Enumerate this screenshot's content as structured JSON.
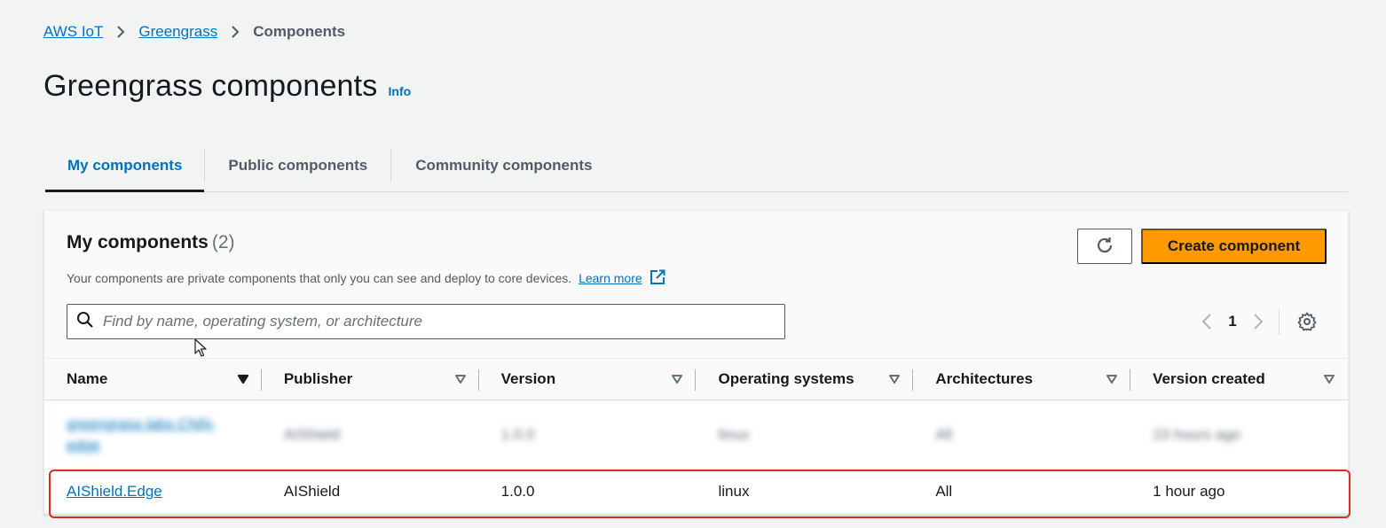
{
  "breadcrumb": {
    "items": [
      "AWS IoT",
      "Greengrass"
    ],
    "current": "Components"
  },
  "page": {
    "title": "Greengrass components",
    "info": "Info"
  },
  "tabs": [
    {
      "label": "My components",
      "active": true
    },
    {
      "label": "Public components",
      "active": false
    },
    {
      "label": "Community components",
      "active": false
    }
  ],
  "panel": {
    "title": "My components",
    "count": "(2)",
    "description": "Your components are private components that only you can see and deploy to core devices.",
    "learn_more": "Learn more",
    "create_label": "Create component",
    "refresh_icon": "refresh-icon",
    "settings_icon": "gear-icon"
  },
  "search": {
    "placeholder": "Find by name, operating system, or architecture",
    "value": ""
  },
  "pagination": {
    "page": "1"
  },
  "table": {
    "columns": [
      "Name",
      "Publisher",
      "Version",
      "Operating systems",
      "Architectures",
      "Version created"
    ],
    "rows": [
      {
        "name": "greengrass.labs.CNN-edge",
        "publisher": "AIShield",
        "version": "1.0.0",
        "os": "linux",
        "arch": "All",
        "created": "23 hours ago",
        "blurred": true
      },
      {
        "name": "AIShield.Edge",
        "publisher": "AIShield",
        "version": "1.0.0",
        "os": "linux",
        "arch": "All",
        "created": "1 hour ago",
        "blurred": false
      }
    ]
  },
  "colors": {
    "primary_button": "#ff9900",
    "link": "#0073bb",
    "highlight": "#e02b2b"
  }
}
